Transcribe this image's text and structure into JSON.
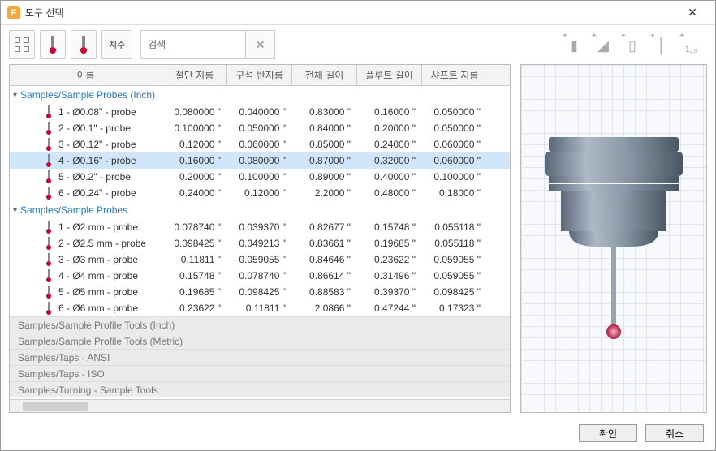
{
  "window": {
    "title": "도구 선택",
    "close": "✕"
  },
  "toolbar": {
    "dim_label": "치수",
    "search_placeholder": "검색",
    "clear": "✕"
  },
  "columns": {
    "name": "이름",
    "cut_dia": "절단 지름",
    "corner_r": "구석 반지름",
    "total_len": "전체 길이",
    "flute_len": "플루트 길이",
    "shaft_dia": "샤프트 지름"
  },
  "groups": [
    {
      "name": "Samples/Sample Probes (Inch)",
      "expanded": true,
      "rows": [
        {
          "name": "1 - Ø0.08\" - probe",
          "cut": "0.080000 \"",
          "corner": "0.040000 \"",
          "total": "0.83000 \"",
          "flute": "0.16000 \"",
          "shaft": "0.050000 \"",
          "selected": false
        },
        {
          "name": "2 - Ø0.1\" - probe",
          "cut": "0.100000 \"",
          "corner": "0.050000 \"",
          "total": "0.84000 \"",
          "flute": "0.20000 \"",
          "shaft": "0.050000 \"",
          "selected": false
        },
        {
          "name": "3 - Ø0.12\" - probe",
          "cut": "0.12000 \"",
          "corner": "0.060000 \"",
          "total": "0.85000 \"",
          "flute": "0.24000 \"",
          "shaft": "0.060000 \"",
          "selected": false
        },
        {
          "name": "4 - Ø0.16\" - probe",
          "cut": "0.16000 \"",
          "corner": "0.080000 \"",
          "total": "0.87000 \"",
          "flute": "0.32000 \"",
          "shaft": "0.060000 \"",
          "selected": true
        },
        {
          "name": "5 - Ø0.2\" - probe",
          "cut": "0.20000 \"",
          "corner": "0.100000 \"",
          "total": "0.89000 \"",
          "flute": "0.40000 \"",
          "shaft": "0.100000 \"",
          "selected": false
        },
        {
          "name": "6 - Ø0.24\" - probe",
          "cut": "0.24000 \"",
          "corner": "0.12000 \"",
          "total": "2.2000 \"",
          "flute": "0.48000 \"",
          "shaft": "0.18000 \"",
          "selected": false
        }
      ]
    },
    {
      "name": "Samples/Sample Probes",
      "expanded": true,
      "rows": [
        {
          "name": "1 - Ø2 mm - probe",
          "cut": "0.078740 \"",
          "corner": "0.039370 \"",
          "total": "0.82677 \"",
          "flute": "0.15748 \"",
          "shaft": "0.055118 \"",
          "selected": false
        },
        {
          "name": "2 - Ø2.5 mm - probe",
          "cut": "0.098425 \"",
          "corner": "0.049213 \"",
          "total": "0.83661 \"",
          "flute": "0.19685 \"",
          "shaft": "0.055118 \"",
          "selected": false
        },
        {
          "name": "3 - Ø3 mm - probe",
          "cut": "0.11811 \"",
          "corner": "0.059055 \"",
          "total": "0.84646 \"",
          "flute": "0.23622 \"",
          "shaft": "0.059055 \"",
          "selected": false
        },
        {
          "name": "4 - Ø4 mm - probe",
          "cut": "0.15748 \"",
          "corner": "0.078740 \"",
          "total": "0.86614 \"",
          "flute": "0.31496 \"",
          "shaft": "0.059055 \"",
          "selected": false
        },
        {
          "name": "5 - Ø5 mm - probe",
          "cut": "0.19685 \"",
          "corner": "0.098425 \"",
          "total": "0.88583 \"",
          "flute": "0.39370 \"",
          "shaft": "0.098425 \"",
          "selected": false
        },
        {
          "name": "6 - Ø6 mm - probe",
          "cut": "0.23622 \"",
          "corner": "0.11811 \"",
          "total": "2.0866 \"",
          "flute": "0.47244 \"",
          "shaft": "0.17323 \"",
          "selected": false
        }
      ]
    }
  ],
  "collapsed_groups": [
    "Samples/Sample Profile Tools (Inch)",
    "Samples/Sample Profile Tools (Metric)",
    "Samples/Taps - ANSI",
    "Samples/Taps - ISO",
    "Samples/Turning - Sample Tools"
  ],
  "buttons": {
    "ok": "확인",
    "cancel": "취소"
  },
  "right_icons": [
    "▮",
    "▲",
    "▯",
    "▼",
    "1₂₃"
  ]
}
